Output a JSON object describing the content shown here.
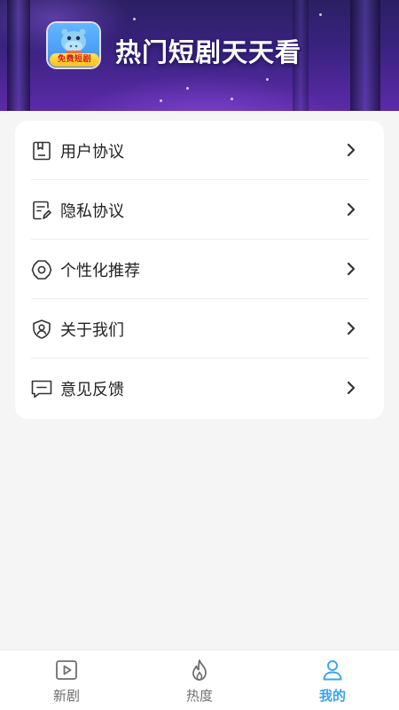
{
  "banner": {
    "title": "热门短剧天天看",
    "app_badge": "免费短剧"
  },
  "menu": {
    "items": [
      {
        "label": "用户协议",
        "icon": "document-icon"
      },
      {
        "label": "隐私协议",
        "icon": "edit-document-icon"
      },
      {
        "label": "个性化推荐",
        "icon": "gear-icon"
      },
      {
        "label": "关于我们",
        "icon": "shield-user-icon"
      },
      {
        "label": "意见反馈",
        "icon": "message-icon"
      }
    ]
  },
  "tabbar": {
    "tabs": [
      {
        "label": "新剧",
        "icon": "video-play-icon",
        "active": false
      },
      {
        "label": "热度",
        "icon": "flame-icon",
        "active": false
      },
      {
        "label": "我的",
        "icon": "user-icon",
        "active": true
      }
    ],
    "active_color": "#3aa3ef",
    "inactive_color": "#6e6e6e"
  }
}
